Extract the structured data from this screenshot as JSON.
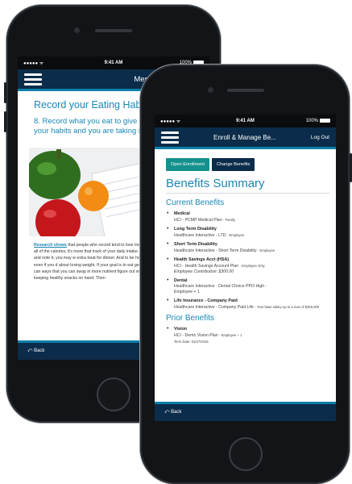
{
  "back_phone": {
    "status": {
      "carrier": "●●●●● ᯤ",
      "time": "9:41 AM",
      "battery": "100%"
    },
    "nav": {
      "title": "Messages & Activit..."
    },
    "article": {
      "title": "Record your Eating Habit",
      "step_text": "8. Record what you eat to give y better sense of your habits and you are taking in.",
      "body_link": "Research shows",
      "body_text": " that people who record tend to lose more weight. It's not even th counting all of the calories; it's more that track of your daily intake. For example: if cookie with lunch, and note it, you may w extra treat for dinner. And to be honest, what you eat can be helpful even if you d about losing weight. If your goal is to eat getting a sense of your food habits can ways that you can swap in more nutrient figure out when you're always hungry and by keeping healthy snacks on hand. Then"
    },
    "bottom": {
      "back_label": "Back"
    }
  },
  "front_phone": {
    "status": {
      "carrier": "●●●●● ᯤ",
      "time": "9:41 AM",
      "battery": "100%"
    },
    "nav": {
      "title": "Enroll & Manage Be...",
      "logout": "Log Out"
    },
    "buttons": {
      "open_enrollment": "Open Enrollment",
      "change_benefits": "Change Benefits"
    },
    "page_title": "Benefits Summary",
    "current_heading": "Current Benefits",
    "current_benefits": [
      {
        "name": "Medical",
        "line1": "HCI - PCMP Medical Plan",
        "line1_small": "- Family"
      },
      {
        "name": "Long Term Disability",
        "line1": "Healthcare Interactive - LTD",
        "line1_small": "- Employee"
      },
      {
        "name": "Short Term Disability",
        "line1": "Healthcare Interactive - Short Term Disability",
        "line1_small": "- Employee"
      },
      {
        "name": "Health Savings Acct (HSA)",
        "line1": "HCI - Health Savings Account Plan",
        "line1_small": "- Employee Only",
        "line2": "Employee Contribution: $300.00"
      },
      {
        "name": "Dental",
        "line1": "Healthcare Interactive - Dental Choice PPO High -",
        "line1_small": "",
        "line2": "Employee + 1"
      },
      {
        "name": "Life Insurance - Company Paid",
        "line1": "Healthcare Interactive - Company Paid Life",
        "line1_small": "- Your base salary up to a max of $250,000"
      }
    ],
    "prior_heading": "Prior Benefits",
    "prior_benefits": [
      {
        "name": "Vision",
        "line1": "HCI - Demo Vision Plan",
        "line1_small": "- Employee + 1",
        "line2": "Term Date: 01/27/2016"
      }
    ],
    "bottom": {
      "back_label": "Back"
    }
  },
  "colors": {
    "navy": "#0b2c4a",
    "accent_blue": "#1a87b4",
    "teal_button": "#15918d",
    "nav_underline": "#0e7fa9"
  },
  "icons": [
    "hamburger-menu-icon",
    "back-arrow-icon",
    "wifi-icon",
    "battery-icon"
  ]
}
